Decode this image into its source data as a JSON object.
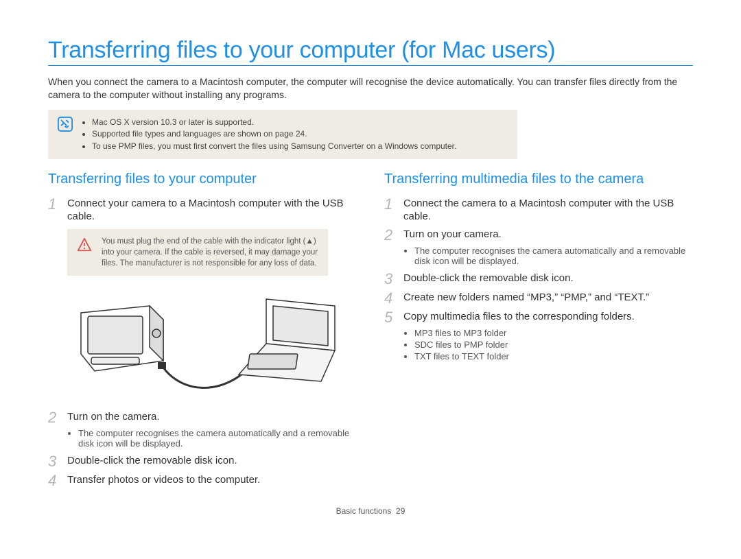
{
  "title": "Transferring files to your computer (for Mac users)",
  "intro": "When you connect the camera to a Macintosh computer, the computer will recognise the device automatically. You can transfer files directly from the camera to the computer without installing any programs.",
  "notes": [
    "Mac OS X version 10.3 or later is supported.",
    "Supported file types and languages are shown on page 24.",
    "To use PMP files, you must first convert the files using Samsung Converter on a Windows computer."
  ],
  "left": {
    "heading": "Transferring files to your computer",
    "steps": [
      {
        "n": "1",
        "text": "Connect your camera to a Macintosh computer with the USB cable."
      },
      {
        "n": "2",
        "text": "Turn on the camera."
      },
      {
        "n": "3",
        "text": "Double-click the removable disk icon."
      },
      {
        "n": "4",
        "text": "Transfer photos or videos to the computer."
      }
    ],
    "warning": "You must plug the end of the cable with the indicator light (▲) into your camera. If the cable is reversed, it may damage your files. The manufacturer is not responsible for any loss of data.",
    "step2_sub": [
      "The computer recognises the camera automatically and a removable disk icon will be displayed."
    ]
  },
  "right": {
    "heading": "Transferring multimedia files to the camera",
    "steps": [
      {
        "n": "1",
        "text": "Connect the camera to a Macintosh computer with the USB cable."
      },
      {
        "n": "2",
        "text": "Turn on your camera."
      },
      {
        "n": "3",
        "text": "Double-click the removable disk icon."
      },
      {
        "n": "4",
        "text": "Create new folders named “MP3,” “PMP,” and “TEXT.”"
      },
      {
        "n": "5",
        "text": "Copy multimedia files to the corresponding folders."
      }
    ],
    "step2_sub": [
      "The computer recognises the camera automatically and a removable disk icon will be displayed."
    ],
    "step5_sub": [
      "MP3 files to MP3 folder",
      "SDC files to PMP folder",
      "TXT files to TEXT folder"
    ]
  },
  "footer_label": "Basic functions",
  "footer_page": "29"
}
